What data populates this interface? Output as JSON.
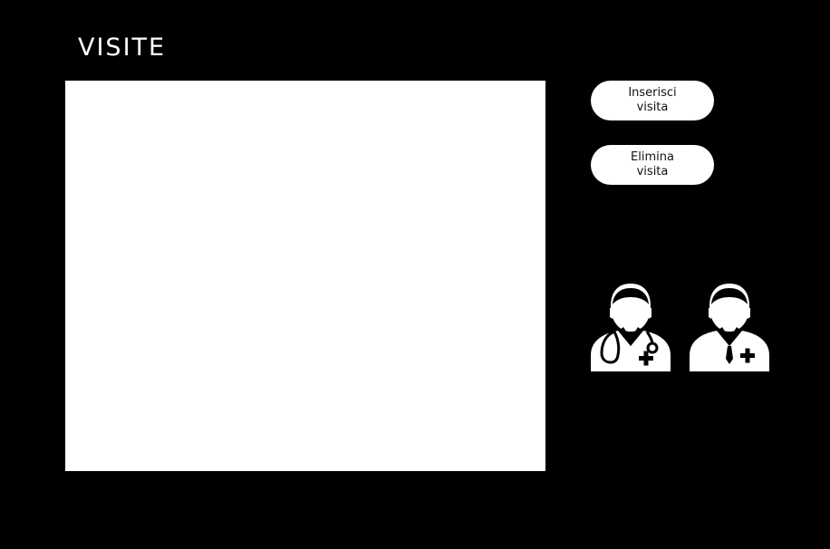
{
  "page": {
    "title": "VISITE"
  },
  "actions": {
    "insert_label": "Inserisci\nvisita",
    "delete_label": "Elimina\nvisita"
  },
  "icons": {
    "doctor_with_stethoscope": "doctor-stethoscope-icon",
    "doctor": "doctor-icon"
  },
  "colors": {
    "background": "#000000",
    "panel": "#ffffff",
    "button": "#ffffff",
    "button_text": "#111111"
  }
}
